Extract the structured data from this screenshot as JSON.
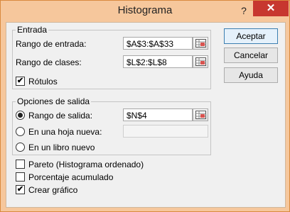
{
  "dialog": {
    "title": "Histograma",
    "help_glyph": "?",
    "close_glyph": "✕"
  },
  "entrada": {
    "legend": "Entrada",
    "rango_entrada_label": "Rango de entrada:",
    "rango_entrada_value": "$A$3:$A$33",
    "rango_clases_label": "Rango de clases:",
    "rango_clases_value": "$L$2:$L$8",
    "rotulos_label": "Rótulos",
    "rotulos_checked": true
  },
  "salida": {
    "legend": "Opciones de salida",
    "rango_salida_label": "Rango de salida:",
    "rango_salida_value": "$N$4",
    "rango_salida_selected": true,
    "hoja_nueva_label": "En una hoja nueva:",
    "hoja_nueva_value": "",
    "libro_nuevo_label": "En un libro nuevo"
  },
  "options": {
    "pareto_label": "Pareto (Histograma ordenado)",
    "pareto_checked": false,
    "porcentaje_label": "Porcentaje acumulado",
    "porcentaje_checked": false,
    "grafico_label": "Crear gráfico",
    "grafico_checked": true
  },
  "buttons": {
    "aceptar": "Aceptar",
    "cancelar": "Cancelar",
    "ayuda": "Ayuda"
  },
  "icons": {
    "ref_collapse": "range-select-icon",
    "check": "✔"
  },
  "colors": {
    "title_bar": "#f6c79c",
    "close_button": "#c7372f",
    "client_bg": "#f0f0f0",
    "primary_border": "#3c7fb1"
  }
}
